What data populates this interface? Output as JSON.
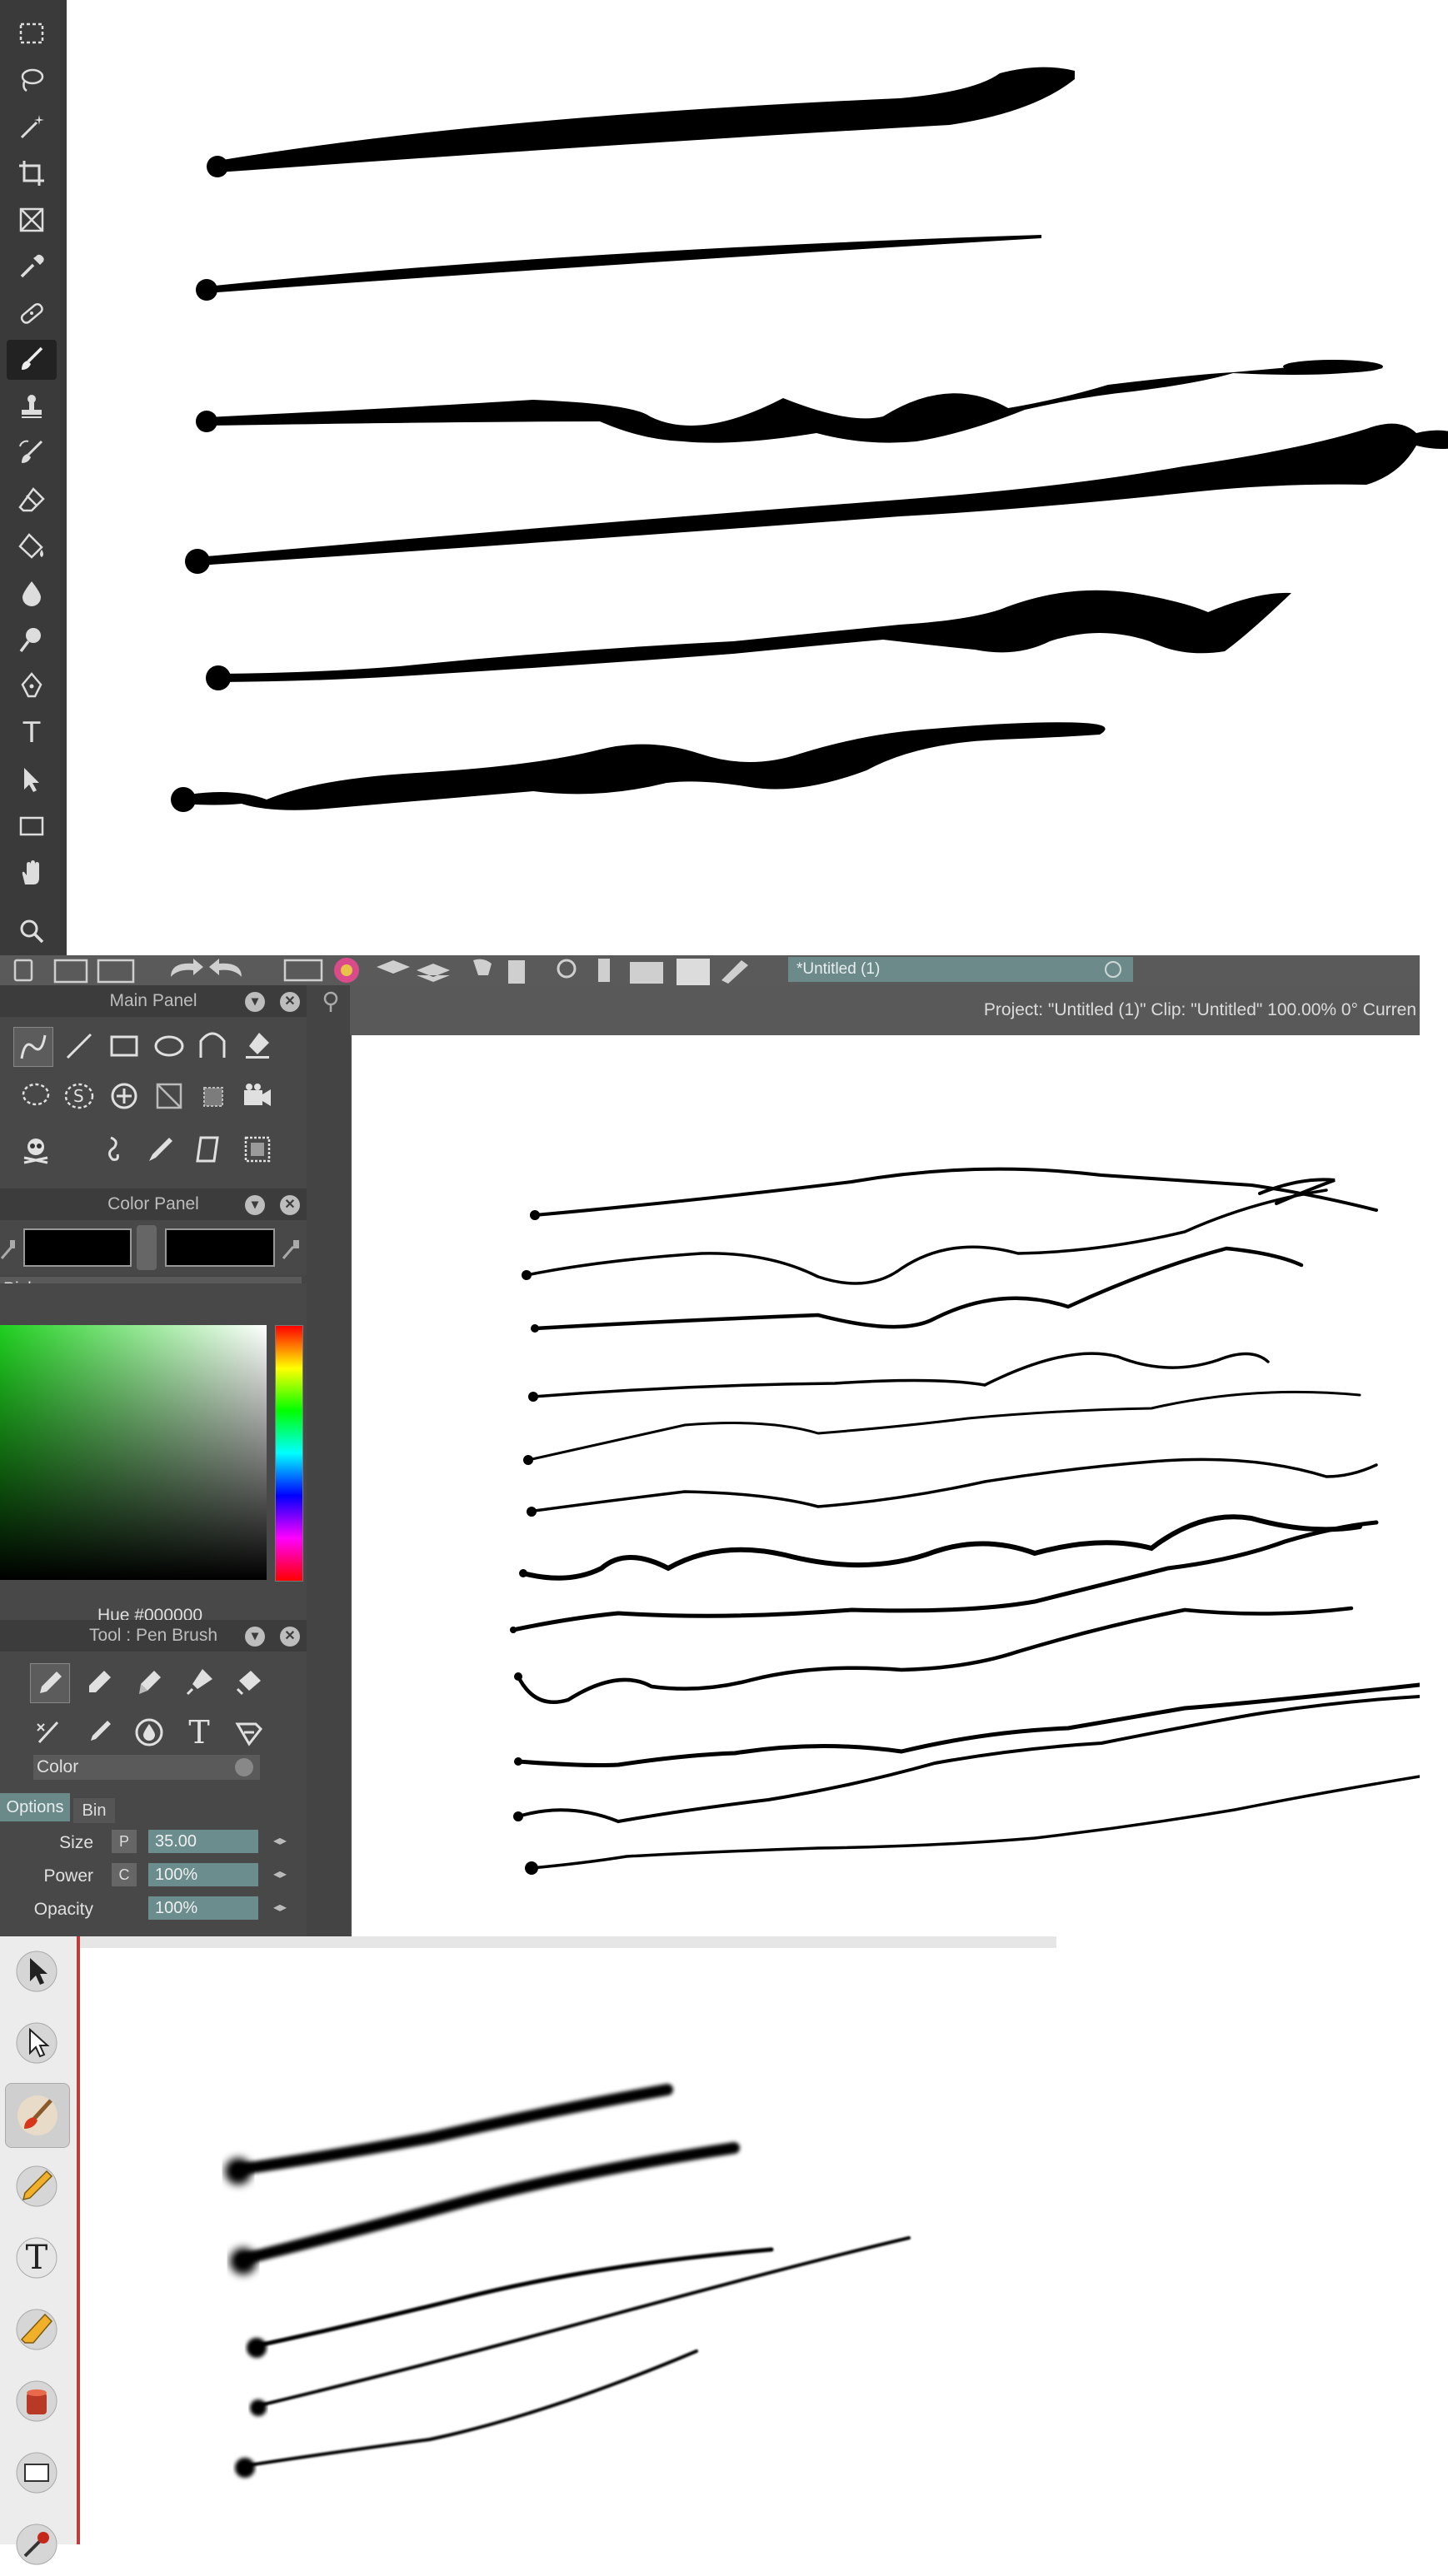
{
  "section_a": {
    "toolbar": {
      "tools": [
        {
          "name": "rectangle-select-icon"
        },
        {
          "name": "lasso-icon"
        },
        {
          "name": "magic-wand-icon"
        },
        {
          "name": "crop-icon"
        },
        {
          "name": "frame-icon"
        },
        {
          "name": "eyedropper-icon"
        },
        {
          "name": "healing-brush-icon"
        },
        {
          "name": "brush-icon",
          "active": true
        },
        {
          "name": "stamp-icon"
        },
        {
          "name": "history-brush-icon"
        },
        {
          "name": "eraser-icon"
        },
        {
          "name": "paint-bucket-icon"
        },
        {
          "name": "blur-icon"
        },
        {
          "name": "dodge-icon"
        },
        {
          "name": "pen-icon"
        },
        {
          "name": "type-icon",
          "glyph": "T"
        },
        {
          "name": "path-select-icon"
        },
        {
          "name": "rectangle-shape-icon"
        },
        {
          "name": "hand-icon"
        },
        {
          "name": "zoom-icon"
        }
      ]
    }
  },
  "section_b": {
    "document_tab": "*Untitled (1)",
    "status_bar": "Project:  \"Untitled (1)\"  Clip: \"Untitled\"   100.00%   0°  Curren",
    "main_panel": {
      "title": "Main Panel"
    },
    "color_panel": {
      "title": "Color Panel",
      "picker_label": "Picker",
      "hue_label": "Hue  #000000",
      "colors": {
        "primary": "#000000",
        "secondary": "#000000"
      }
    },
    "tool_panel": {
      "title": "Tool : Pen Brush",
      "dropdown": "Color",
      "tabs": [
        "Options",
        "Bin"
      ],
      "options": [
        {
          "label": "Size",
          "mode": "P",
          "value": "35.00"
        },
        {
          "label": "Power",
          "mode": "C",
          "value": "100%"
        },
        {
          "label": "Opacity",
          "mode": "",
          "value": "100%"
        }
      ]
    },
    "type_tool_glyph": "T"
  },
  "section_c": {
    "toolbar": {
      "tools": [
        {
          "name": "arrow-select-icon"
        },
        {
          "name": "direct-select-icon"
        },
        {
          "name": "paint-brush-icon",
          "active": true
        },
        {
          "name": "pencil-icon"
        },
        {
          "name": "text-icon",
          "glyph": "T"
        },
        {
          "name": "eraser-icon"
        },
        {
          "name": "paint-bucket-icon"
        },
        {
          "name": "shape-icon"
        },
        {
          "name": "eyedropper-icon"
        },
        {
          "name": "lasso-icon"
        }
      ]
    }
  }
}
